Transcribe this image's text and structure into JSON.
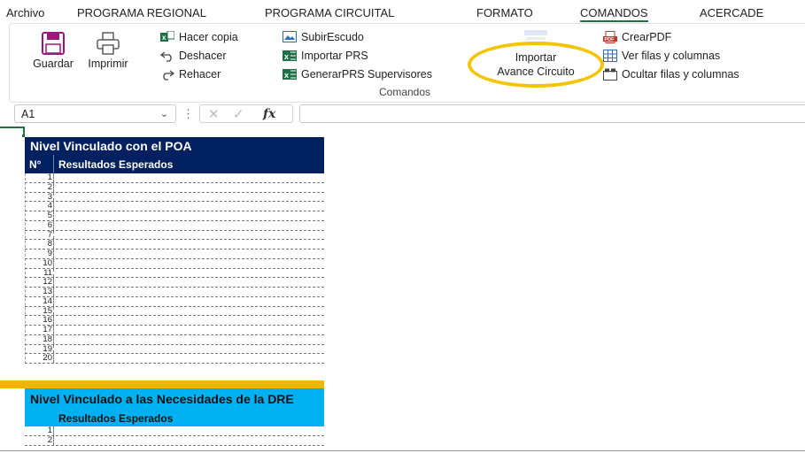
{
  "menu": {
    "items": [
      "Archivo",
      "PROGRAMA REGIONAL",
      "PROGRAMA CIRCUITAL",
      "FORMATO",
      "COMANDOS",
      "ACERCADE"
    ],
    "active": "COMANDOS"
  },
  "ribbon": {
    "guardar": "Guardar",
    "imprimir": "Imprimir",
    "hacer_copia": "Hacer copia",
    "deshacer": "Deshacer",
    "rehacer": "Rehacer",
    "subir_escudo": "SubirEscudo",
    "importar_prs": "Importar PRS",
    "generar_prs": "GenerarPRS Supervisores",
    "importar_avance_1": "Importar",
    "importar_avance_2": "Avance Circuito",
    "crear_pdf": "CrearPDF",
    "ver_filas": "Ver filas y columnas",
    "ocultar_filas": "Ocultar filas y columnas",
    "group_label": "Comandos"
  },
  "formula_bar": {
    "name_box": "A1",
    "fx": "fx",
    "formula": ""
  },
  "sheet": {
    "section1_title": "Nivel Vinculado con el POA",
    "col_num": "N°",
    "col_results": "Resultados Esperados",
    "rows1": [
      "1",
      "2",
      "3",
      "4",
      "5",
      "6",
      "7",
      "8",
      "9",
      "10",
      "11",
      "12",
      "13",
      "14",
      "15",
      "16",
      "17",
      "18",
      "19",
      "20"
    ],
    "section2_title": "Nivel Vinculado a las Necesidades de la DRE",
    "col_results2": "Resultados Esperados",
    "rows2": [
      "1",
      "2"
    ]
  },
  "colors": {
    "accent": "#1e7145",
    "header_dark": "#002060",
    "header_cyan": "#00b0f0",
    "separator_orange": "#f5b400",
    "highlight": "#f2c500"
  }
}
